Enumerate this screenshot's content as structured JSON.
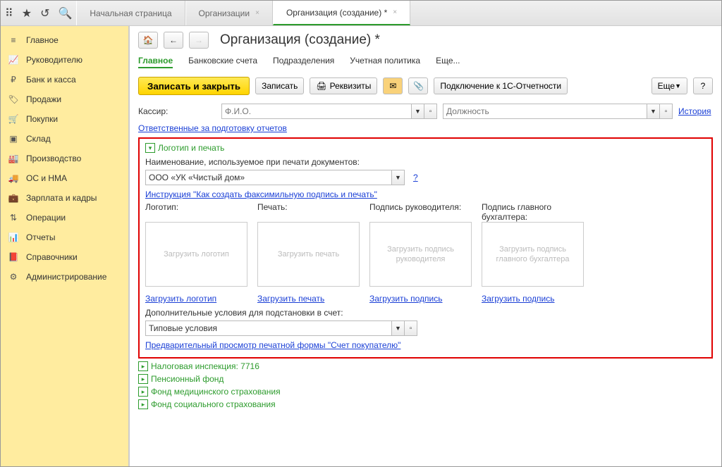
{
  "top_tabs": {
    "start": "Начальная страница",
    "orgs": "Организации",
    "create": "Организация (создание) *"
  },
  "sidebar": [
    {
      "label": "Главное"
    },
    {
      "label": "Руководителю"
    },
    {
      "label": "Банк и касса"
    },
    {
      "label": "Продажи"
    },
    {
      "label": "Покупки"
    },
    {
      "label": "Склад"
    },
    {
      "label": "Производство"
    },
    {
      "label": "ОС и НМА"
    },
    {
      "label": "Зарплата и кадры"
    },
    {
      "label": "Операции"
    },
    {
      "label": "Отчеты"
    },
    {
      "label": "Справочники"
    },
    {
      "label": "Администрирование"
    }
  ],
  "page_title": "Организация (создание) *",
  "subtabs": {
    "main": "Главное",
    "bank": "Банковские счета",
    "subdiv": "Подразделения",
    "policy": "Учетная политика",
    "more": "Еще..."
  },
  "toolbar": {
    "save_close": "Записать и закрыть",
    "save": "Записать",
    "req": "Реквизиты",
    "connect": "Подключение к 1С-Отчетности",
    "more": "Еще"
  },
  "cashier": {
    "label": "Кассир:",
    "fio_placeholder": "Ф.И.О.",
    "pos_placeholder": "Должность",
    "history": "История"
  },
  "link_responsible": "Ответственные за подготовку отчетов",
  "logo_section": {
    "title": "Логотип и печать",
    "print_name_label": "Наименование, используемое при печати документов:",
    "print_name_value": "ООО «УК «Чистый дом»",
    "instr_link": "Инструкция \"Как создать факсимильную подпись и печать\"",
    "cols": {
      "logo": {
        "label": "Логотип:",
        "ph": "Загрузить логотип",
        "link": "Загрузить логотип"
      },
      "stamp": {
        "label": "Печать:",
        "ph": "Загрузить печать",
        "link": "Загрузить печать"
      },
      "dir": {
        "label": "Подпись руководителя:",
        "ph": "Загрузить  подпись руководителя",
        "link": "Загрузить подпись"
      },
      "acc": {
        "label": "Подпись главного бухгалтера:",
        "ph": "Загрузить подпись главного бухгалтера",
        "link": "Загрузить подпись"
      }
    },
    "extra_cond_label": "Дополнительные условия для подстановки в счет:",
    "extra_cond_value": "Типовые условия",
    "preview_link": "Предварительный просмотр печатной формы \"Счет покупателю\""
  },
  "expanders": {
    "tax": "Налоговая инспекция: 7716",
    "pfr": "Пенсионный фонд",
    "fms": "Фонд медицинского страхования",
    "fss": "Фонд социального страхования"
  }
}
